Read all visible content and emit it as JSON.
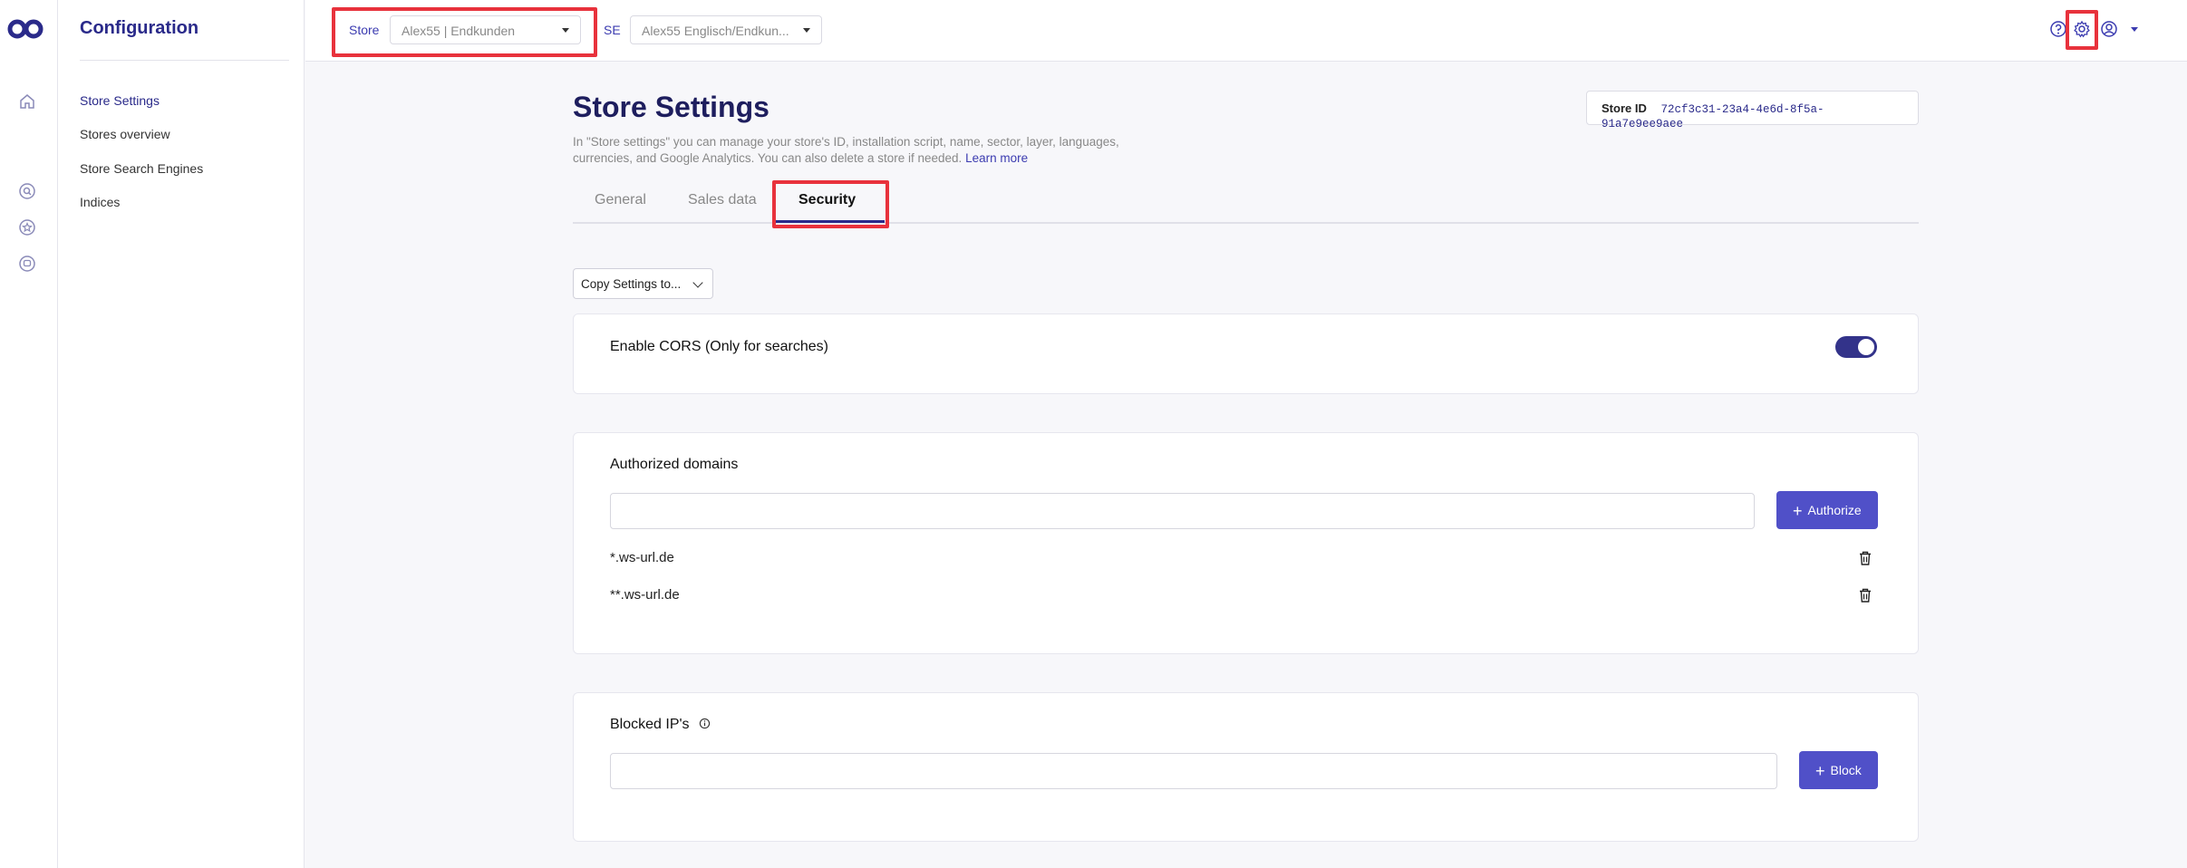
{
  "sidebar": {
    "title": "Configuration",
    "items": [
      {
        "label": "Store Settings"
      },
      {
        "label": "Stores overview"
      },
      {
        "label": "Store Search Engines"
      },
      {
        "label": "Indices"
      }
    ]
  },
  "topbar": {
    "store_label": "Store",
    "store_value": "Alex55 | Endkunden",
    "se_label": "SE",
    "se_value": "Alex55 Englisch/Endkun..."
  },
  "page": {
    "title": "Store Settings",
    "description": "In \"Store settings\" you can manage your store's ID, installation script, name, sector, layer, languages, currencies, and Google Analytics. You can also delete a store if needed.",
    "learn_more": "Learn more",
    "store_id_label": "Store ID",
    "store_id_value": "72cf3c31-23a4-4e6d-8f5a-91a7e9ee9aee"
  },
  "tabs": [
    {
      "label": "General"
    },
    {
      "label": "Sales data"
    },
    {
      "label": "Security"
    }
  ],
  "copy_settings": {
    "label": "Copy Settings to..."
  },
  "cors": {
    "label": "Enable CORS (Only for searches)",
    "enabled": true
  },
  "authorized_domains": {
    "title": "Authorized domains",
    "input_value": "",
    "button_label": "Authorize",
    "domains": [
      "*.ws-url.de",
      "**.ws-url.de"
    ]
  },
  "blocked_ips": {
    "title": "Blocked IP's",
    "input_value": "",
    "button_label": "Block"
  },
  "colors": {
    "accent": "#2a2a8a",
    "button": "#5050c8",
    "highlight": "#e8323c"
  }
}
